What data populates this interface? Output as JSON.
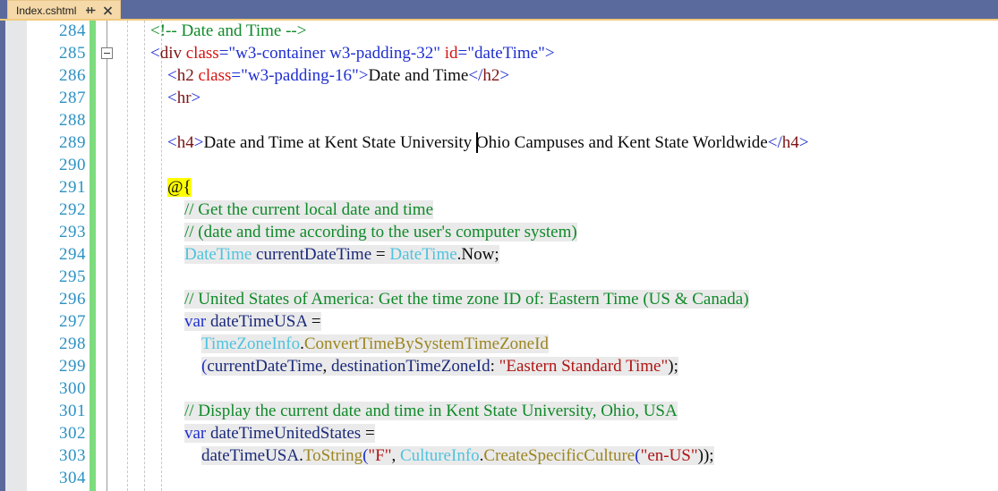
{
  "window": {
    "tab": {
      "title": "Index.cshtml",
      "pin_icon": "pin-icon",
      "close_icon": "close-icon"
    },
    "tabstrip_color": "#5a6a9c",
    "tab_color": "#f5d9a8"
  },
  "editor": {
    "first_line": 284,
    "last_line": 304,
    "change_bar_color": "#7ddc7d",
    "line_number_color": "#2b91c4",
    "caret": {
      "line": 289,
      "after_text": "Date and Time at Kent State University "
    },
    "highlight_color": "#ffff00",
    "code_block_bg": "#eaeaea",
    "lines": [
      {
        "num": 284,
        "razor": false,
        "indent": 0,
        "tokens": [
          {
            "t": "<!-- Date and Time -->",
            "c": "t-comment"
          }
        ]
      },
      {
        "num": 285,
        "razor": false,
        "indent": 0,
        "collapse": true,
        "tokens": [
          {
            "t": "<",
            "c": "t-punct"
          },
          {
            "t": "div",
            "c": "t-tag"
          },
          {
            "t": " ",
            "c": "t-plain"
          },
          {
            "t": "class",
            "c": "t-attr"
          },
          {
            "t": "=",
            "c": "t-punct"
          },
          {
            "t": "\"w3-container w3-padding-32\"",
            "c": "t-attrval"
          },
          {
            "t": " ",
            "c": "t-plain"
          },
          {
            "t": "id",
            "c": "t-attr"
          },
          {
            "t": "=",
            "c": "t-punct"
          },
          {
            "t": "\"dateTime\"",
            "c": "t-attrval"
          },
          {
            "t": ">",
            "c": "t-punct"
          }
        ]
      },
      {
        "num": 286,
        "razor": false,
        "indent": 1,
        "tokens": [
          {
            "t": "<",
            "c": "t-punct"
          },
          {
            "t": "h2",
            "c": "t-tag"
          },
          {
            "t": " ",
            "c": "t-plain"
          },
          {
            "t": "class",
            "c": "t-attr"
          },
          {
            "t": "=",
            "c": "t-punct"
          },
          {
            "t": "\"w3-padding-16\"",
            "c": "t-attrval"
          },
          {
            "t": ">",
            "c": "t-punct"
          },
          {
            "t": "Date and Time",
            "c": "t-text"
          },
          {
            "t": "</",
            "c": "t-punct"
          },
          {
            "t": "h2",
            "c": "t-tag"
          },
          {
            "t": ">",
            "c": "t-punct"
          }
        ]
      },
      {
        "num": 287,
        "razor": false,
        "indent": 1,
        "tokens": [
          {
            "t": "<",
            "c": "t-punct"
          },
          {
            "t": "hr",
            "c": "t-tag"
          },
          {
            "t": ">",
            "c": "t-punct"
          }
        ]
      },
      {
        "num": 288,
        "razor": false,
        "indent": 0,
        "tokens": []
      },
      {
        "num": 289,
        "razor": false,
        "indent": 1,
        "tokens": [
          {
            "t": "<",
            "c": "t-punct"
          },
          {
            "t": "h4",
            "c": "t-tag"
          },
          {
            "t": ">",
            "c": "t-punct"
          },
          {
            "t": "Date and Time at Kent State University Ohio Campuses and Kent State Worldwide",
            "c": "t-text"
          },
          {
            "t": "</",
            "c": "t-punct"
          },
          {
            "t": "h4",
            "c": "t-tag"
          },
          {
            "t": ">",
            "c": "t-punct"
          }
        ]
      },
      {
        "num": 290,
        "razor": false,
        "indent": 0,
        "tokens": []
      },
      {
        "num": 291,
        "razor": true,
        "indent": 1,
        "tokens": [
          {
            "t": "@{",
            "c": "hl-yellow"
          }
        ]
      },
      {
        "num": 292,
        "razor": true,
        "indent": 2,
        "tokens": [
          {
            "t": "// Get the current local date and time",
            "c": "t-comment"
          }
        ]
      },
      {
        "num": 293,
        "razor": true,
        "indent": 2,
        "tokens": [
          {
            "t": "// (date and time according to the user's computer system)",
            "c": "t-comment"
          }
        ]
      },
      {
        "num": 294,
        "razor": true,
        "indent": 2,
        "tokens": [
          {
            "t": "DateTime",
            "c": "t-type"
          },
          {
            "t": " ",
            "c": "t-plain"
          },
          {
            "t": "currentDateTime",
            "c": "t-ident"
          },
          {
            "t": " = ",
            "c": "t-op"
          },
          {
            "t": "DateTime",
            "c": "t-type"
          },
          {
            "t": ".Now;",
            "c": "t-plain"
          }
        ]
      },
      {
        "num": 295,
        "razor": false,
        "indent": 0,
        "tokens": []
      },
      {
        "num": 296,
        "razor": true,
        "indent": 2,
        "tokens": [
          {
            "t": "// United States of America: Get the time zone ID of: Eastern Time (US & Canada)",
            "c": "t-comment"
          }
        ]
      },
      {
        "num": 297,
        "razor": true,
        "indent": 2,
        "tokens": [
          {
            "t": "var",
            "c": "t-kw"
          },
          {
            "t": " ",
            "c": "t-plain"
          },
          {
            "t": "dateTimeUSA",
            "c": "t-ident"
          },
          {
            "t": " =",
            "c": "t-op"
          }
        ]
      },
      {
        "num": 298,
        "razor": true,
        "indent": 3,
        "tokens": [
          {
            "t": "TimeZoneInfo",
            "c": "t-type"
          },
          {
            "t": ".",
            "c": "t-plain"
          },
          {
            "t": "ConvertTimeBySystemTimeZoneId",
            "c": "t-method"
          }
        ]
      },
      {
        "num": 299,
        "razor": true,
        "indent": 3,
        "tokens": [
          {
            "t": "(",
            "c": "t-punct"
          },
          {
            "t": "currentDateTime",
            "c": "t-ident"
          },
          {
            "t": ", ",
            "c": "t-plain"
          },
          {
            "t": "destinationTimeZoneId",
            "c": "t-ident"
          },
          {
            "t": ": ",
            "c": "t-plain"
          },
          {
            "t": "\"Eastern Standard Time\"",
            "c": "t-string"
          },
          {
            "t": ");",
            "c": "t-plain"
          }
        ]
      },
      {
        "num": 300,
        "razor": false,
        "indent": 0,
        "tokens": []
      },
      {
        "num": 301,
        "razor": true,
        "indent": 2,
        "tokens": [
          {
            "t": "// Display the current date and time in Kent State University, Ohio, USA",
            "c": "t-comment"
          }
        ]
      },
      {
        "num": 302,
        "razor": true,
        "indent": 2,
        "tokens": [
          {
            "t": "var",
            "c": "t-kw"
          },
          {
            "t": " ",
            "c": "t-plain"
          },
          {
            "t": "dateTimeUnitedStates",
            "c": "t-ident"
          },
          {
            "t": " =",
            "c": "t-op"
          }
        ]
      },
      {
        "num": 303,
        "razor": true,
        "indent": 3,
        "tokens": [
          {
            "t": "dateTimeUSA",
            "c": "t-ident"
          },
          {
            "t": ".",
            "c": "t-plain"
          },
          {
            "t": "ToString",
            "c": "t-method"
          },
          {
            "t": "(",
            "c": "t-punct"
          },
          {
            "t": "\"F\"",
            "c": "t-string"
          },
          {
            "t": ", ",
            "c": "t-plain"
          },
          {
            "t": "CultureInfo",
            "c": "t-type"
          },
          {
            "t": ".",
            "c": "t-plain"
          },
          {
            "t": "CreateSpecificCulture",
            "c": "t-method"
          },
          {
            "t": "(",
            "c": "t-punct"
          },
          {
            "t": "\"en-US\"",
            "c": "t-string"
          },
          {
            "t": "));",
            "c": "t-plain"
          }
        ]
      },
      {
        "num": 304,
        "razor": true,
        "indent": 2,
        "tokens": []
      }
    ]
  }
}
